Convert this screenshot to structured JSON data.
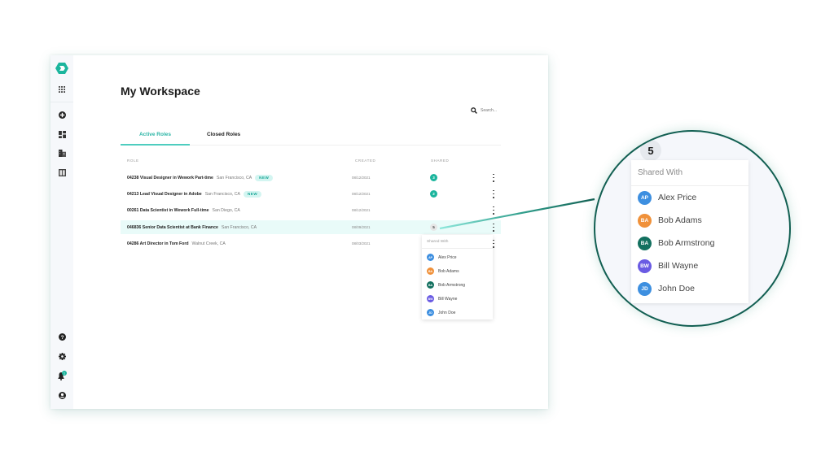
{
  "app": {
    "title": "My Workspace",
    "brand_color": "#1bb59d",
    "accent_color": "#4ecdbf"
  },
  "sidebar": {
    "top_items": [
      {
        "icon": "logo-icon"
      },
      {
        "icon": "apps-grid-icon"
      }
    ],
    "items": [
      {
        "icon": "add-circle-icon"
      },
      {
        "icon": "dashboard-icon"
      },
      {
        "icon": "building-icon"
      },
      {
        "icon": "board-icon"
      }
    ],
    "bottom_items": [
      {
        "icon": "help-icon"
      },
      {
        "icon": "settings-icon"
      },
      {
        "icon": "notifications-icon",
        "badge": "1"
      },
      {
        "icon": "account-icon"
      }
    ]
  },
  "search": {
    "placeholder": "Search..."
  },
  "tabs": [
    {
      "label": "Active Roles",
      "active": true
    },
    {
      "label": "Closed Roles",
      "active": false
    }
  ],
  "table": {
    "columns": [
      "ROLE",
      "CREATED",
      "SHARED"
    ],
    "rows": [
      {
        "role": "04238 Visual Designer in Wework Part-time",
        "location": "San Francisco, CA",
        "badge": "NEW",
        "created": "08/12/2021",
        "shared": "3"
      },
      {
        "role": "04213 Lead Visual Designer in Adobe",
        "location": "San Francisco, CA",
        "badge": "NEW",
        "created": "08/12/2021",
        "shared": "2"
      },
      {
        "role": "00261 Data Scientist in Wework Full-time",
        "location": "San Diego, CA",
        "badge": "",
        "created": "08/12/2021",
        "shared": ""
      },
      {
        "role": "046836 Senior Data Scientist at Bank Finance",
        "location": "San Francisco, CA",
        "badge": "",
        "created": "08/09/2021",
        "shared": "5",
        "highlighted": true
      },
      {
        "role": "04286 Art Director in Tom Ford",
        "location": "Walnut Creek, CA",
        "badge": "",
        "created": "08/03/2021",
        "shared": ""
      }
    ]
  },
  "shared_popup": {
    "title": "Shared With",
    "count": "5",
    "people": [
      {
        "initials": "AP",
        "name": "Alex Price",
        "color": "#3d8fe0"
      },
      {
        "initials": "BA",
        "name": "Bob Adams",
        "color": "#f0913a"
      },
      {
        "initials": "BA",
        "name": "Bob Armstrong",
        "color": "#13705f"
      },
      {
        "initials": "BW",
        "name": "Bill Wayne",
        "color": "#6a5be3"
      },
      {
        "initials": "JD",
        "name": "John Doe",
        "color": "#3d8fe0"
      }
    ]
  }
}
